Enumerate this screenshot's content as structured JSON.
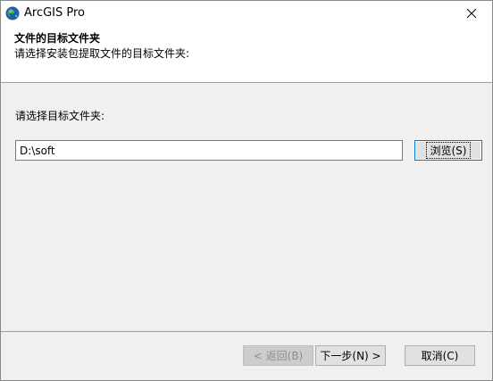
{
  "window": {
    "title": "ArcGIS Pro",
    "app_icon": "arcgis-globe-icon",
    "close_icon": "close-icon"
  },
  "header": {
    "title": "文件的目标文件夹",
    "subtitle": "请选择安装包提取文件的目标文件夹:"
  },
  "main": {
    "prompt": "请选择目标文件夹:",
    "path_value": "D:\\soft",
    "browse_label": "浏览(S)"
  },
  "footer": {
    "back_label": "< 返回(B)",
    "next_label": "下一步(N) >",
    "cancel_label": "取消(C)"
  }
}
